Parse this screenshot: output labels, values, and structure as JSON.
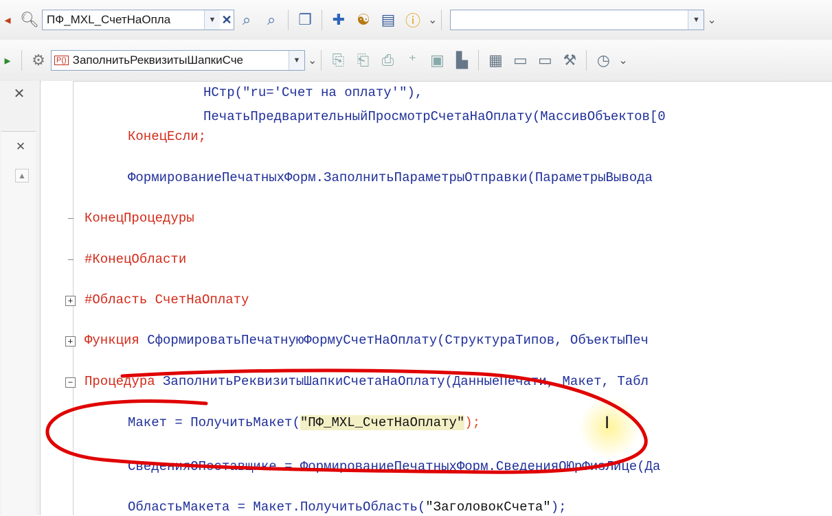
{
  "toolbar1": {
    "form_combo_value": "ПФ_MXL_СчетНаОпла",
    "search_combo_value": ""
  },
  "toolbar2": {
    "method_combo_value": "ЗаполнитьРеквизитыШапкиСче",
    "method_badge": "P()"
  },
  "code": {
    "l1a": "НСтр(\"ru='Счет на оплату'\"),",
    "l2a": "ПечатьПредварительныйПросмотрСчетаНаОплату(МассивОбъектов[0",
    "l3_kw": "КонецЕсли;",
    "l4a": "ФормированиеПечатныхФорм.ЗаполнитьПараметрыОтправки(ПараметрыВывода",
    "l5_kw": "КонецПроцедуры",
    "l6_kw": "#КонецОбласти",
    "l7_kw": "#Область",
    "l7_name": " СчетНаОплату",
    "l8_kw": "Функция",
    "l8_rest": " СформироватьПечатнуюФормуСчетНаОплату(СтруктураТипов, ОбъектыПеч",
    "l9_kw": "Процедура",
    "l9_rest": " ЗаполнитьРеквизитыШапкиСчетаНаОплату(ДанныеПечати, Макет, Табл",
    "l10_a": "Макет = ПолучитьМакет(",
    "l10_str": "\"ПФ_MXL_СчетНаОплату\"",
    "l10_end": ");",
    "l11a": "СведенияОПоставщике = ФормированиеПечатныхФорм.СведенияОЮрФизЛице(Да",
    "l12_a": "ОбластьМакета = Макет.ПолучитьОбласть(",
    "l12_str": "\"ЗаголовокСчета\"",
    "l12_end": ");"
  },
  "colors": {
    "keyword": "#d22b1a",
    "identifier": "#1f2f9a",
    "string": "#111111",
    "annotation": "#e00000"
  },
  "icons": [
    "search-icon",
    "dropdown-icon",
    "clear-icon",
    "find-icon",
    "find-next-icon",
    "copy-icon",
    "debug-icon",
    "breakpoint-icon",
    "module-icon",
    "info-icon",
    "procedure-icon",
    "indent-icon",
    "outdent-icon",
    "comment-icon",
    "uncomment-icon",
    "bookmark-icon",
    "timer-icon"
  ]
}
